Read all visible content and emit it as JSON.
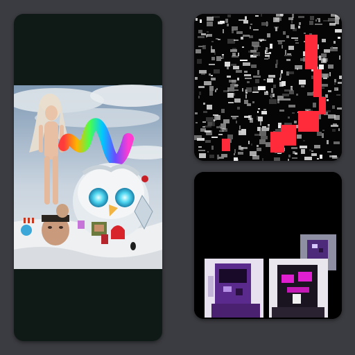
{
  "gallery": {
    "items": [
      {
        "name": "surreal-snow-scene-artwork",
        "kind": "collage"
      },
      {
        "name": "glitch-black-red-artwork",
        "kind": "glitch"
      },
      {
        "name": "glitch-portraits-artwork",
        "kind": "glitch-portraits"
      }
    ]
  },
  "colors": {
    "background": "#3b3c41",
    "card_left": "#0f1a17",
    "card_dark": "#000000",
    "glitch_red": "#ff2a3a",
    "glitch_purple": "#6a2a9a",
    "glitch_magenta": "#e01fd0"
  }
}
